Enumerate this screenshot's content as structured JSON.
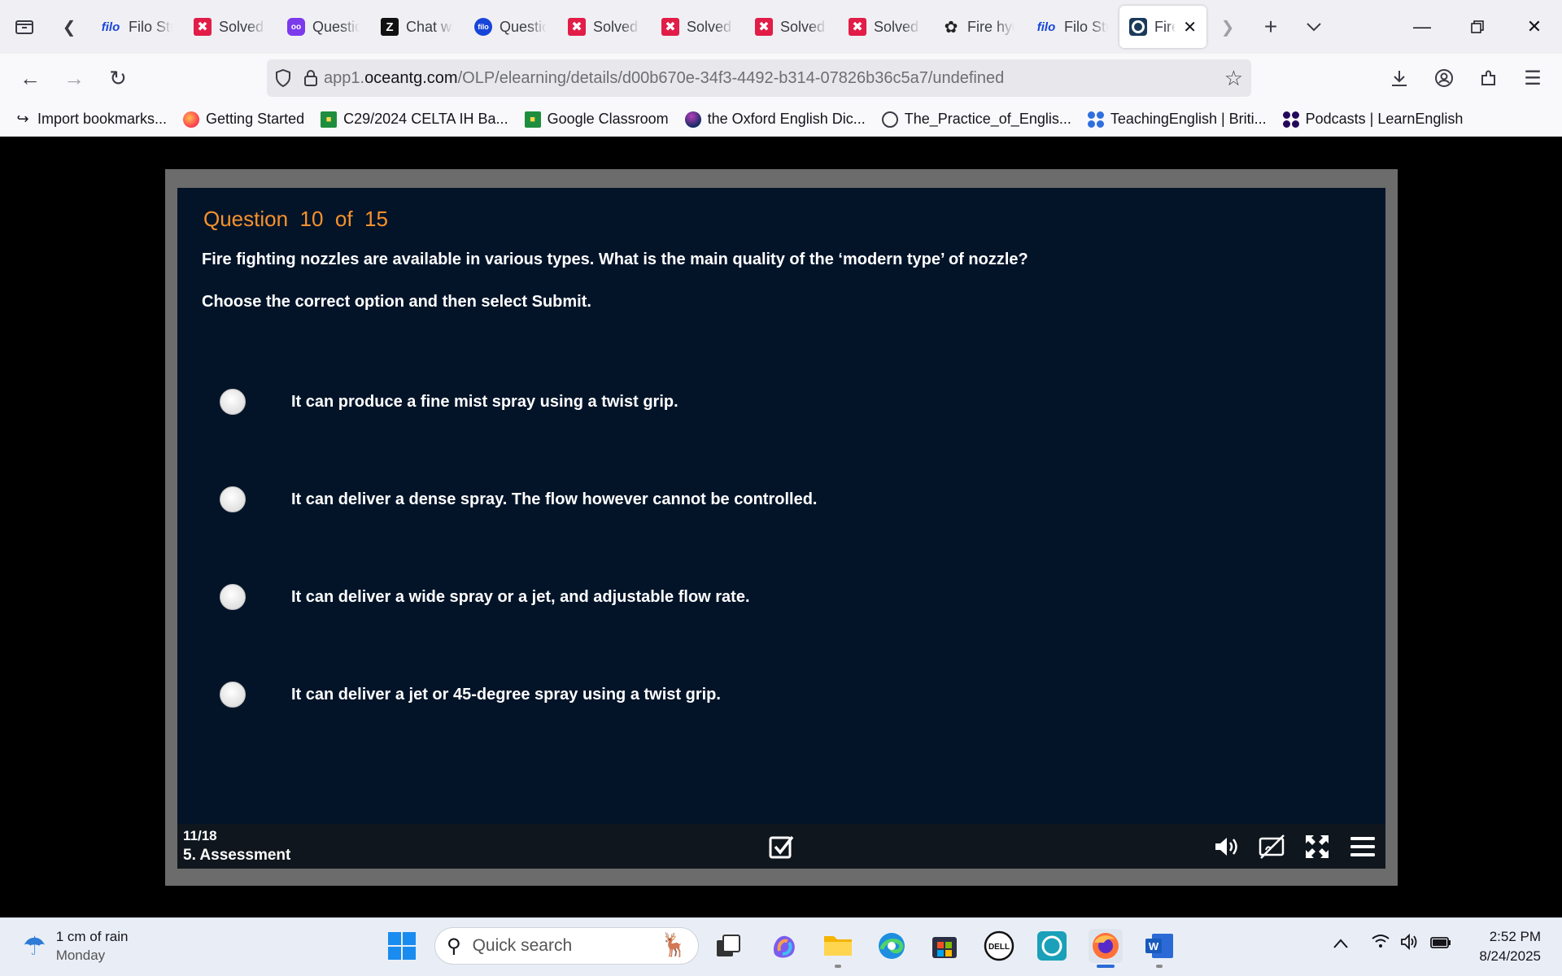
{
  "browser": {
    "tabs": [
      {
        "favicon": "filo",
        "label": "Filo Student"
      },
      {
        "favicon": "solvely",
        "label": "Solved"
      },
      {
        "favicon": "question-ai",
        "label": "Question"
      },
      {
        "favicon": "z-logo",
        "label": "Chat with"
      },
      {
        "favicon": "filo-circle",
        "label": "Question"
      },
      {
        "favicon": "solvely",
        "label": "Solved"
      },
      {
        "favicon": "solvely",
        "label": "Solved"
      },
      {
        "favicon": "solvely",
        "label": "Solved"
      },
      {
        "favicon": "solvely",
        "label": "Solved"
      },
      {
        "favicon": "openai",
        "label": "Fire hydrant"
      },
      {
        "favicon": "filo",
        "label": "Filo Student"
      },
      {
        "favicon": "ocean",
        "label": "Fire",
        "active": true
      }
    ],
    "url": {
      "prefix": "app1.",
      "domain": "oceantg.com",
      "path": "/OLP/elearning/details/d00b670e-34f3-4492-b314-07826b36c5a7/undefined"
    },
    "bookmarks": [
      {
        "icon": "import-icon",
        "label": "Import bookmarks..."
      },
      {
        "icon": "firefox-icon",
        "label": "Getting Started"
      },
      {
        "icon": "classroom-icon",
        "label": "C29/2024 CELTA IH Ba..."
      },
      {
        "icon": "classroom-icon",
        "label": "Google Classroom"
      },
      {
        "icon": "oxford-icon",
        "label": "the Oxford English Dic..."
      },
      {
        "icon": "globe-icon",
        "label": "The_Practice_of_Englis..."
      },
      {
        "icon": "british-council-icon",
        "label": "TeachingEnglish | Briti..."
      },
      {
        "icon": "british-council-dark-icon",
        "label": "Podcasts | LearnEnglish"
      }
    ]
  },
  "quiz": {
    "question_number_label": "Question  10  of  15",
    "question": "Fire fighting nozzles are available in various types. What is the main quality of the ‘modern type’ of nozzle?",
    "instruction": "Choose the correct option and then select Submit.",
    "options": [
      "It can produce a fine mist spray using a twist grip.",
      "It can deliver a dense spray. The flow however cannot be controlled.",
      "It can deliver a wide spray or a jet, and adjustable flow rate.",
      "It can deliver a jet or 45-degree spray using a twist grip."
    ],
    "player": {
      "progress": "11/18",
      "section": "5. Assessment"
    }
  },
  "taskbar": {
    "weather": {
      "line1": "1 cm of rain",
      "line2": "Monday"
    },
    "search_placeholder": "Quick search",
    "clock": {
      "time": "2:52 PM",
      "date": "8/24/2025"
    }
  },
  "colors": {
    "slide_bg": "#031429",
    "question_number": "#f7912d",
    "player_frame": "#6c6c6c",
    "control_bar": "#10161d"
  }
}
